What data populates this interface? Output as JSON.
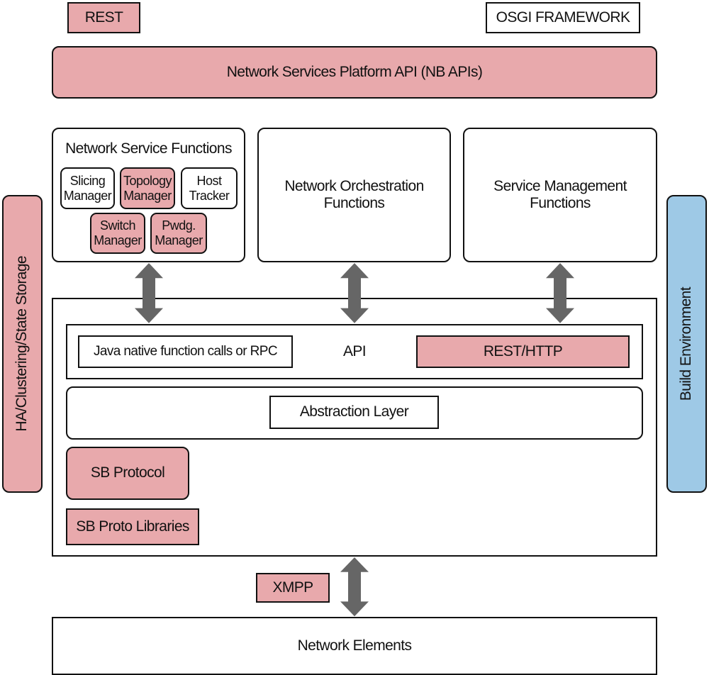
{
  "colors": {
    "highlight": "#e8a9ac",
    "build": "#9ec9e6",
    "arrow": "#666666"
  },
  "top": {
    "rest": "REST",
    "osgi": "OSGI FRAMEWORK",
    "nb_api": "Network Services Platform API (NB APIs)"
  },
  "functions": {
    "nsf": {
      "title": "Network Service Functions",
      "items": [
        "Slicing Manager",
        "Topology Manager",
        "Host Tracker",
        "Switch Manager",
        "Pwdg. Manager"
      ]
    },
    "nof": "Network Orchestration Functions",
    "smf": "Service Management Functions"
  },
  "side": {
    "ha": "HA/Clustering/State Storage",
    "build": "Build Environment"
  },
  "core": {
    "java": "Java native function calls or RPC",
    "api": "API",
    "rest_http": "REST/HTTP",
    "abstraction": "Abstraction Layer",
    "sb_protocol": "SB Protocol",
    "sb_libs": "SB Proto Libraries"
  },
  "bottom": {
    "xmpp": "XMPP",
    "network_elements": "Network Elements"
  }
}
